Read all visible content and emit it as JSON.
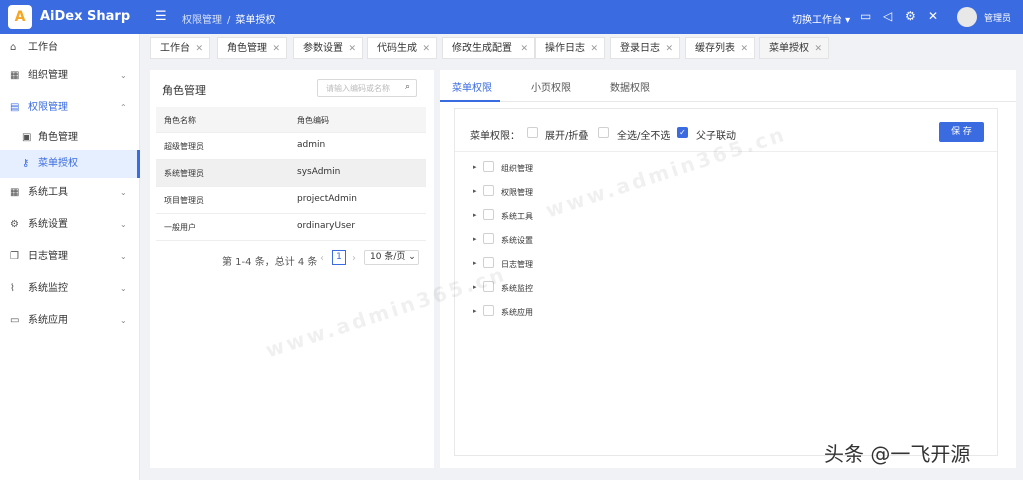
{
  "app": {
    "logo_letter": "A",
    "title": "AiDex Sharp"
  },
  "topbar": {
    "menu_toggle_icon": "menu-fold-icon",
    "breadcrumb": [
      "权限管理",
      "菜单授权"
    ],
    "switch_workspace": "切换工作台",
    "icons": [
      "monitor-icon",
      "sound-icon",
      "gear-icon",
      "fullscreen-icon"
    ],
    "user": "管理员"
  },
  "sidebar": {
    "items": [
      {
        "label": "工作台",
        "icon": "home-icon"
      },
      {
        "label": "组织管理",
        "icon": "grid-icon",
        "arrow": "down"
      },
      {
        "label": "权限管理",
        "icon": "form-icon",
        "arrow": "up",
        "open": true
      },
      {
        "label": "角色管理",
        "icon": "id-card-icon",
        "sub": true
      },
      {
        "label": "菜单授权",
        "icon": "key-icon",
        "sub": true,
        "active": true
      },
      {
        "label": "系统工具",
        "icon": "grid-icon",
        "arrow": "down"
      },
      {
        "label": "系统设置",
        "icon": "gear-icon",
        "arrow": "down"
      },
      {
        "label": "日志管理",
        "icon": "copy-icon",
        "arrow": "down"
      },
      {
        "label": "系统监控",
        "icon": "line-chart-icon",
        "arrow": "down"
      },
      {
        "label": "系统应用",
        "icon": "laptop-icon",
        "arrow": "down"
      }
    ]
  },
  "tabs": [
    {
      "label": "工作台"
    },
    {
      "label": "角色管理"
    },
    {
      "label": "参数设置"
    },
    {
      "label": "代码生成"
    },
    {
      "label": "修改生成配置"
    },
    {
      "label": "操作日志"
    },
    {
      "label": "登录日志"
    },
    {
      "label": "缓存列表"
    },
    {
      "label": "菜单授权",
      "active": true
    }
  ],
  "role_panel": {
    "title": "角色管理",
    "search_placeholder": "请输入编码或名称",
    "columns": [
      "角色名称",
      "角色编码"
    ],
    "rows": [
      {
        "name": "超级管理员",
        "code": "admin"
      },
      {
        "name": "系统管理员",
        "code": "sysAdmin",
        "selected": true
      },
      {
        "name": "项目管理员",
        "code": "projectAdmin"
      },
      {
        "name": "一般用户",
        "code": "ordinaryUser"
      }
    ],
    "pager": {
      "info": "第 1-4 条，总计 4 条",
      "current": "1",
      "page_size": "10 条/页"
    }
  },
  "perm_panel": {
    "tabs": [
      "菜单权限",
      "小页权限",
      "数据权限"
    ],
    "label": "菜单权限：",
    "expand_collapse": "展开/折叠",
    "select_all": "全选/全不选",
    "parent_child_link": "父子联动",
    "parent_child_checked": true,
    "save": "保 存",
    "tree": [
      "组织管理",
      "权限管理",
      "系统工具",
      "系统设置",
      "日志管理",
      "系统监控",
      "系统应用"
    ]
  },
  "watermark": "www.admin365.cn",
  "brand_text": "头条 @一飞开源"
}
